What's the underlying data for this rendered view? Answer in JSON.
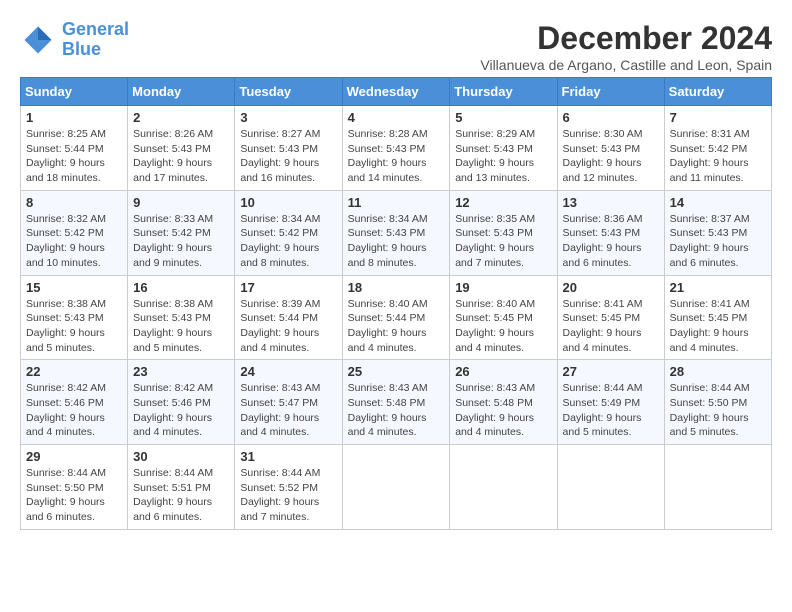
{
  "header": {
    "logo_line1": "General",
    "logo_line2": "Blue",
    "month_title": "December 2024",
    "location": "Villanueva de Argano, Castille and Leon, Spain"
  },
  "weekdays": [
    "Sunday",
    "Monday",
    "Tuesday",
    "Wednesday",
    "Thursday",
    "Friday",
    "Saturday"
  ],
  "weeks": [
    [
      {
        "day": "1",
        "sunrise": "8:25 AM",
        "sunset": "5:44 PM",
        "daylight": "9 hours and 18 minutes."
      },
      {
        "day": "2",
        "sunrise": "8:26 AM",
        "sunset": "5:43 PM",
        "daylight": "9 hours and 17 minutes."
      },
      {
        "day": "3",
        "sunrise": "8:27 AM",
        "sunset": "5:43 PM",
        "daylight": "9 hours and 16 minutes."
      },
      {
        "day": "4",
        "sunrise": "8:28 AM",
        "sunset": "5:43 PM",
        "daylight": "9 hours and 14 minutes."
      },
      {
        "day": "5",
        "sunrise": "8:29 AM",
        "sunset": "5:43 PM",
        "daylight": "9 hours and 13 minutes."
      },
      {
        "day": "6",
        "sunrise": "8:30 AM",
        "sunset": "5:43 PM",
        "daylight": "9 hours and 12 minutes."
      },
      {
        "day": "7",
        "sunrise": "8:31 AM",
        "sunset": "5:42 PM",
        "daylight": "9 hours and 11 minutes."
      }
    ],
    [
      {
        "day": "8",
        "sunrise": "8:32 AM",
        "sunset": "5:42 PM",
        "daylight": "9 hours and 10 minutes."
      },
      {
        "day": "9",
        "sunrise": "8:33 AM",
        "sunset": "5:42 PM",
        "daylight": "9 hours and 9 minutes."
      },
      {
        "day": "10",
        "sunrise": "8:34 AM",
        "sunset": "5:42 PM",
        "daylight": "9 hours and 8 minutes."
      },
      {
        "day": "11",
        "sunrise": "8:34 AM",
        "sunset": "5:43 PM",
        "daylight": "9 hours and 8 minutes."
      },
      {
        "day": "12",
        "sunrise": "8:35 AM",
        "sunset": "5:43 PM",
        "daylight": "9 hours and 7 minutes."
      },
      {
        "day": "13",
        "sunrise": "8:36 AM",
        "sunset": "5:43 PM",
        "daylight": "9 hours and 6 minutes."
      },
      {
        "day": "14",
        "sunrise": "8:37 AM",
        "sunset": "5:43 PM",
        "daylight": "9 hours and 6 minutes."
      }
    ],
    [
      {
        "day": "15",
        "sunrise": "8:38 AM",
        "sunset": "5:43 PM",
        "daylight": "9 hours and 5 minutes."
      },
      {
        "day": "16",
        "sunrise": "8:38 AM",
        "sunset": "5:43 PM",
        "daylight": "9 hours and 5 minutes."
      },
      {
        "day": "17",
        "sunrise": "8:39 AM",
        "sunset": "5:44 PM",
        "daylight": "9 hours and 4 minutes."
      },
      {
        "day": "18",
        "sunrise": "8:40 AM",
        "sunset": "5:44 PM",
        "daylight": "9 hours and 4 minutes."
      },
      {
        "day": "19",
        "sunrise": "8:40 AM",
        "sunset": "5:45 PM",
        "daylight": "9 hours and 4 minutes."
      },
      {
        "day": "20",
        "sunrise": "8:41 AM",
        "sunset": "5:45 PM",
        "daylight": "9 hours and 4 minutes."
      },
      {
        "day": "21",
        "sunrise": "8:41 AM",
        "sunset": "5:45 PM",
        "daylight": "9 hours and 4 minutes."
      }
    ],
    [
      {
        "day": "22",
        "sunrise": "8:42 AM",
        "sunset": "5:46 PM",
        "daylight": "9 hours and 4 minutes."
      },
      {
        "day": "23",
        "sunrise": "8:42 AM",
        "sunset": "5:46 PM",
        "daylight": "9 hours and 4 minutes."
      },
      {
        "day": "24",
        "sunrise": "8:43 AM",
        "sunset": "5:47 PM",
        "daylight": "9 hours and 4 minutes."
      },
      {
        "day": "25",
        "sunrise": "8:43 AM",
        "sunset": "5:48 PM",
        "daylight": "9 hours and 4 minutes."
      },
      {
        "day": "26",
        "sunrise": "8:43 AM",
        "sunset": "5:48 PM",
        "daylight": "9 hours and 4 minutes."
      },
      {
        "day": "27",
        "sunrise": "8:44 AM",
        "sunset": "5:49 PM",
        "daylight": "9 hours and 5 minutes."
      },
      {
        "day": "28",
        "sunrise": "8:44 AM",
        "sunset": "5:50 PM",
        "daylight": "9 hours and 5 minutes."
      }
    ],
    [
      {
        "day": "29",
        "sunrise": "8:44 AM",
        "sunset": "5:50 PM",
        "daylight": "9 hours and 6 minutes."
      },
      {
        "day": "30",
        "sunrise": "8:44 AM",
        "sunset": "5:51 PM",
        "daylight": "9 hours and 6 minutes."
      },
      {
        "day": "31",
        "sunrise": "8:44 AM",
        "sunset": "5:52 PM",
        "daylight": "9 hours and 7 minutes."
      },
      null,
      null,
      null,
      null
    ]
  ]
}
